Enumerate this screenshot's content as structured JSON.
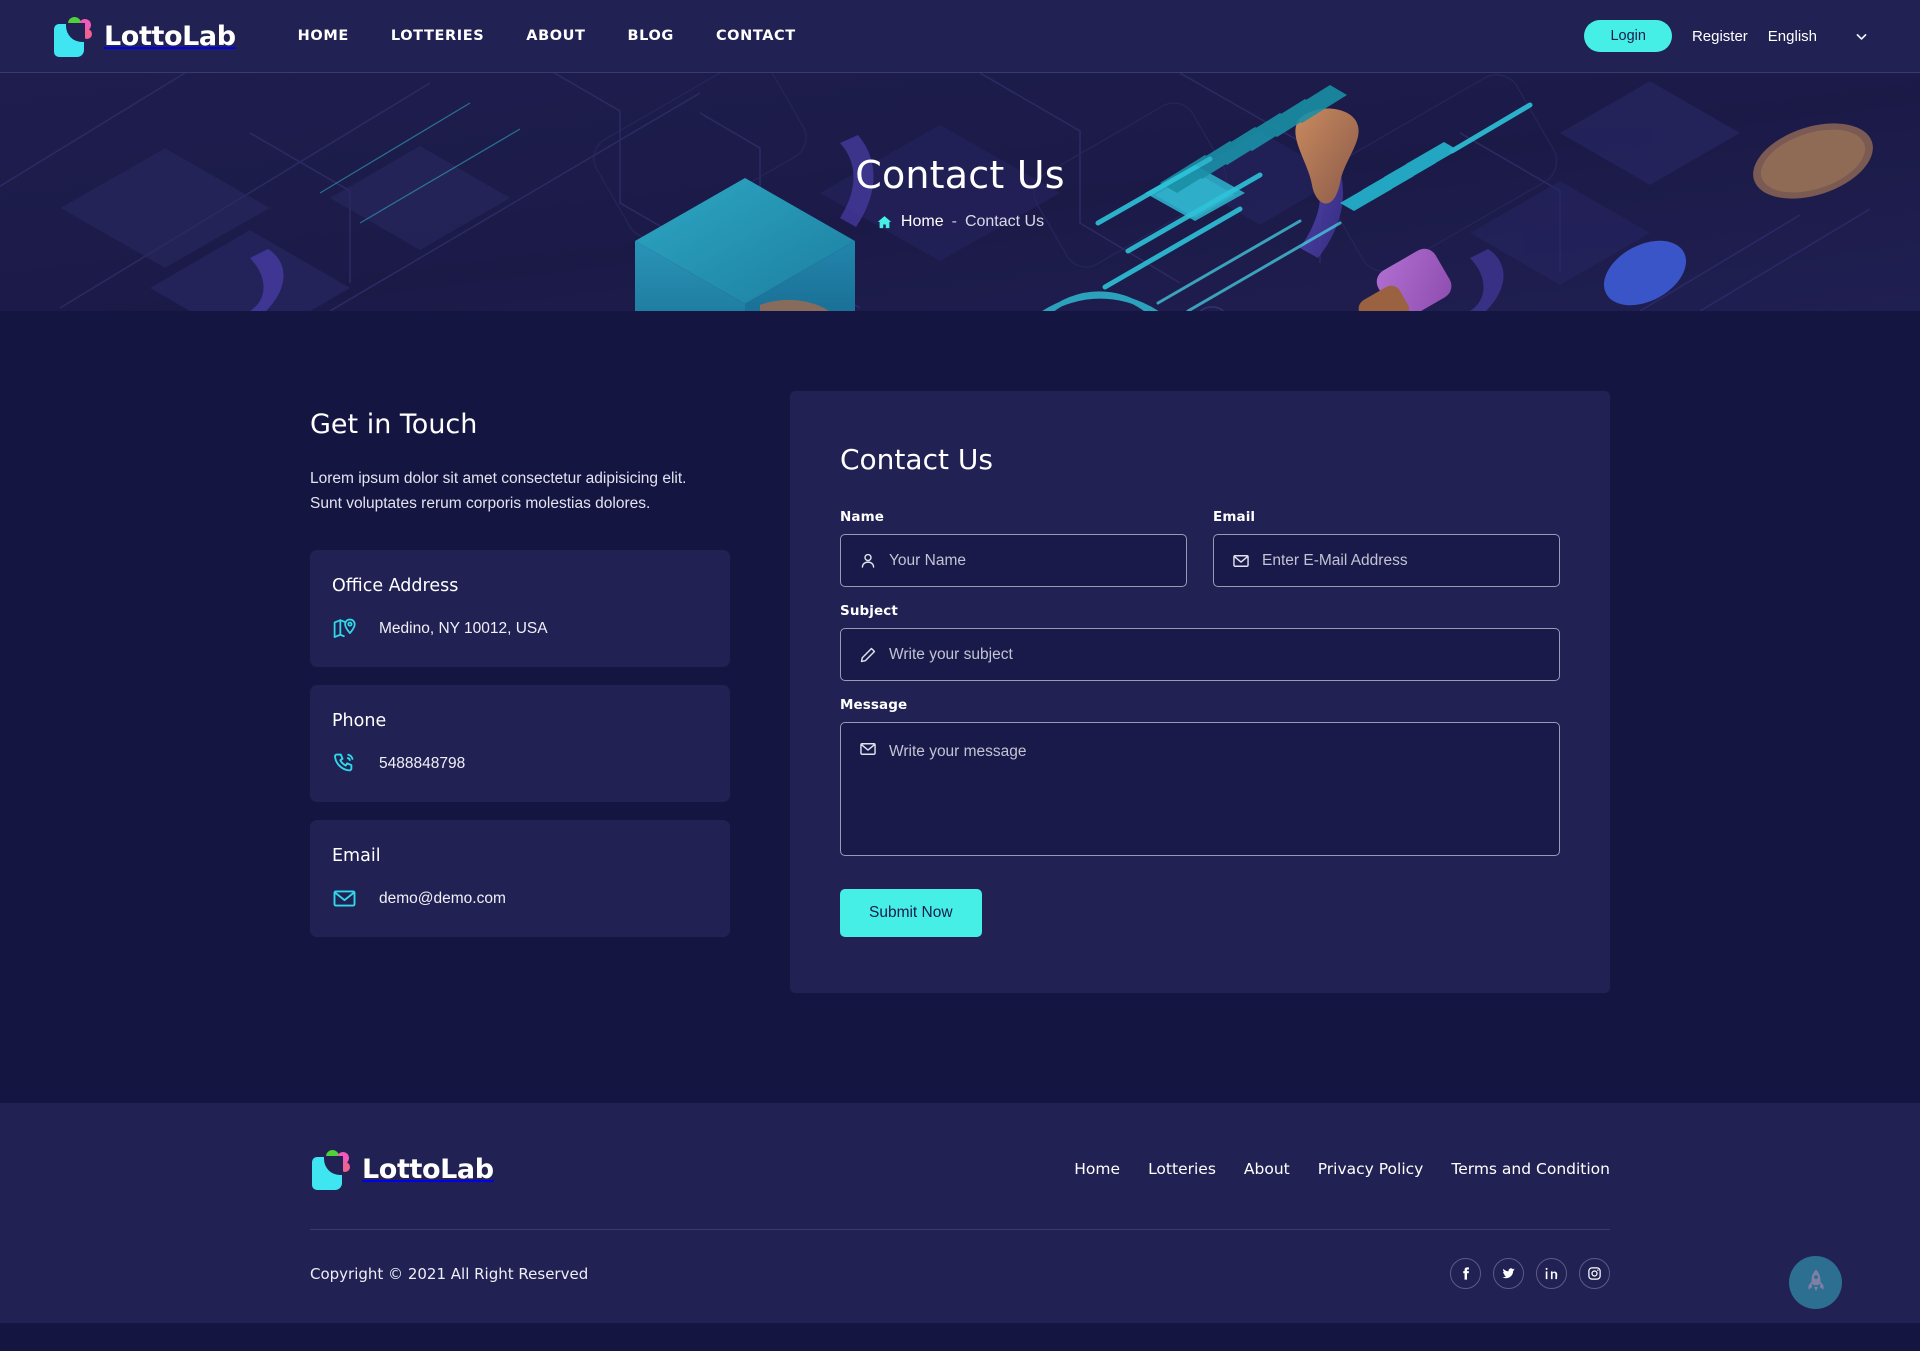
{
  "brand": {
    "name": "LottoLab",
    "icon": "lottery-ticket-icon"
  },
  "header": {
    "nav": [
      {
        "label": "HOME"
      },
      {
        "label": "LOTTERIES"
      },
      {
        "label": "ABOUT"
      },
      {
        "label": "BLOG"
      },
      {
        "label": "CONTACT"
      }
    ],
    "login_label": "Login",
    "register_label": "Register",
    "language": "English",
    "accent_color": "#45efe6"
  },
  "hero": {
    "title": "Contact Us",
    "breadcrumb_home": "Home",
    "breadcrumb_separator": "-",
    "breadcrumb_current": "Contact Us"
  },
  "get_in_touch": {
    "title": "Get in Touch",
    "description": "Lorem ipsum dolor sit amet consectetur adipisicing elit. Sunt voluptates rerum corporis molestias dolores.",
    "cards": [
      {
        "title": "Office Address",
        "value": "Medino, NY 10012, USA",
        "icon": "map-location-icon"
      },
      {
        "title": "Phone",
        "value": "5488848798",
        "icon": "phone-call-icon"
      },
      {
        "title": "Email",
        "value": "demo@demo.com",
        "icon": "envelope-icon"
      }
    ]
  },
  "contact_form": {
    "title": "Contact Us",
    "name_label": "Name",
    "name_placeholder": "Your Name",
    "name_value": "",
    "email_label": "Email",
    "email_placeholder": "Enter E-Mail Address",
    "email_value": "",
    "subject_label": "Subject",
    "subject_placeholder": "Write your subject",
    "subject_value": "",
    "message_label": "Message",
    "message_placeholder": "Write your message",
    "message_value": "",
    "submit_label": "Submit Now"
  },
  "footer": {
    "nav": [
      {
        "label": "Home"
      },
      {
        "label": "Lotteries"
      },
      {
        "label": "About"
      },
      {
        "label": "Privacy Policy"
      },
      {
        "label": "Terms and Condition"
      }
    ],
    "copyright": "Copyright © 2021 All Right Reserved",
    "social": [
      {
        "name": "facebook"
      },
      {
        "name": "twitter"
      },
      {
        "name": "linkedin"
      },
      {
        "name": "instagram"
      }
    ]
  },
  "scroll_top": {
    "icon": "rocket-icon"
  }
}
